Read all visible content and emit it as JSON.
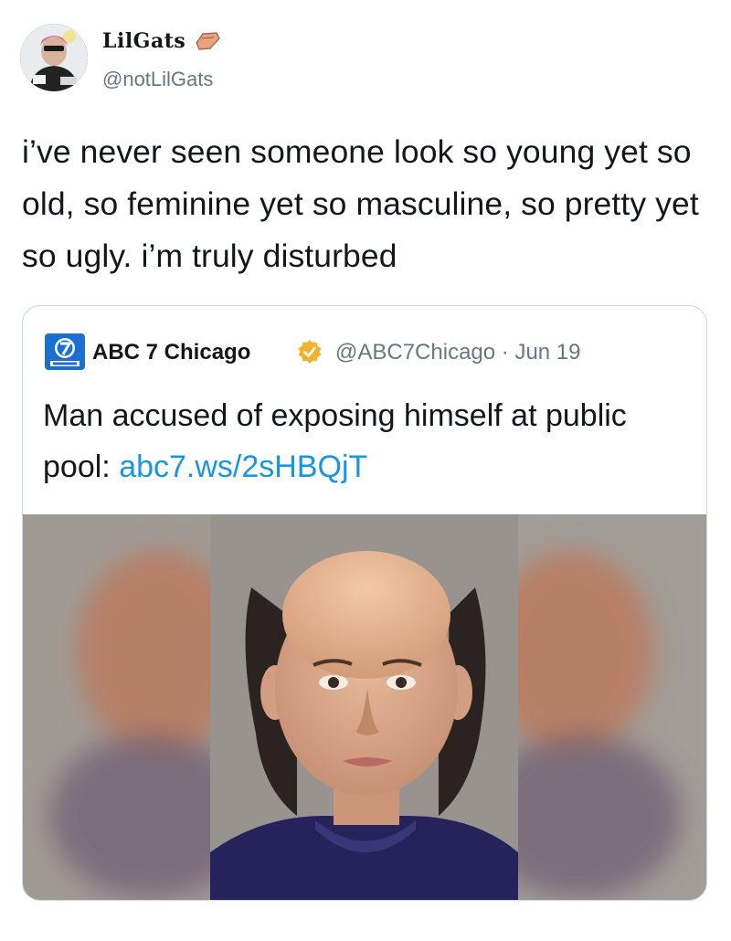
{
  "tweet": {
    "author": {
      "display_name": "LilGats",
      "handle": "@notLilGats",
      "avatar_icon": "user-avatar",
      "name_icon": "coffin-icon"
    },
    "text": "i’ve never seen someone look so young yet so old, so feminine yet so masculine, so pretty yet so ugly. i’m truly disturbed",
    "quoted": {
      "logo_icon": "abc7-logo-icon",
      "name": "ABC 7 Chicago",
      "verified_icon": "verified-badge-icon",
      "handle_date": "@ABC7Chicago · Jun 19",
      "text": "Man accused of exposing himself at public pool: ",
      "link": "abc7.ws/2sHBQjT",
      "image_alt": "mugshot-photo"
    }
  },
  "colors": {
    "text": "#14171a",
    "secondary": "#657786",
    "link": "#1b95e0",
    "border": "#ccd6dd",
    "verified": "#f2b32c"
  }
}
